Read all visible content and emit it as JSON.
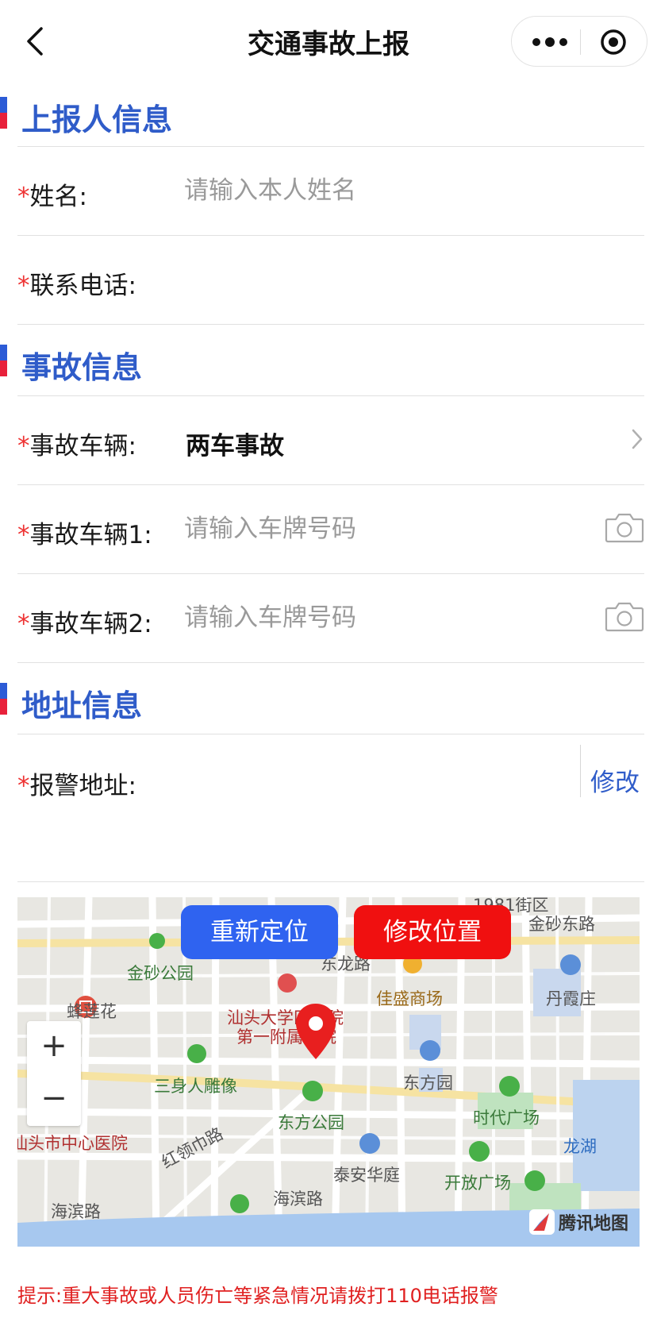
{
  "navbar": {
    "title": "交通事故上报",
    "back_icon": "chevron-left-icon",
    "more_icon": "more-dots-icon",
    "close_icon": "target-circle-icon"
  },
  "reporter_section": {
    "title": "上报人信息",
    "name_label": "姓名:",
    "name_placeholder": "请输入本人姓名",
    "name_value": "",
    "phone_label": "联系电话:",
    "phone_value": "",
    "required_mark": "*"
  },
  "accident_section": {
    "title": "事故信息",
    "vehicle_label": "事故车辆:",
    "vehicle_value": "两车事故",
    "vehicle1_label": "事故车辆1:",
    "vehicle1_placeholder": "请输入车牌号码",
    "vehicle2_label": "事故车辆2:",
    "vehicle2_placeholder": "请输入车牌号码",
    "camera_icon": "camera-icon",
    "chevron_icon": "chevron-right-icon"
  },
  "address_section": {
    "title": "地址信息",
    "address_label": "报警地址:",
    "address_value": "",
    "modify_label": "修改"
  },
  "map": {
    "relocate_button": "重新定位",
    "modify_position_button": "修改位置",
    "zoom_in": "+",
    "zoom_out": "−",
    "attribution": "腾讯地图",
    "labels": {
      "jinsha_east_road": "金砂东路",
      "road_1981": "1981街区",
      "donglong_road": "东龙路",
      "jinsha_park": "金砂公园",
      "jiasheng_mall": "佳盛商场",
      "danxiazhuang": "丹霞庄",
      "fenglianhua": "蜂莲花",
      "shantou_hospital": "汕头大学医学院",
      "first_affiliated": "第一附属医院",
      "sanshenren": "三身人雕像",
      "dongfang_garden": "东方园",
      "dongfang_park": "东方公园",
      "times_square": "时代广场",
      "longhu": "龙湖",
      "central_hospital": "汕头市中心医院",
      "hongling_road": "红领巾路",
      "taian_court": "泰安华庭",
      "open_square": "开放广场",
      "haibin_road_1": "海滨路",
      "haibin_road_2": "海滨路"
    }
  },
  "tip": "提示:重大事故或人员伤亡等紧急情况请拨打110电话报警",
  "colors": {
    "accent_blue": "#2f5cc9",
    "required_red": "#e33333",
    "relocate_blue": "#2f63f0",
    "modify_red": "#f01010"
  }
}
